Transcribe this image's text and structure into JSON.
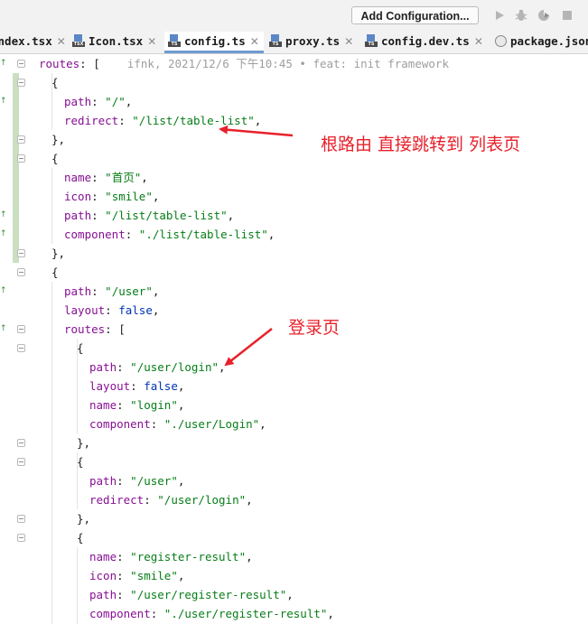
{
  "toolbar": {
    "add_configuration_label": "Add Configuration...",
    "icons": [
      "run-icon",
      "debug-icon",
      "coverage-icon",
      "stop-icon"
    ]
  },
  "tabs": [
    {
      "label": "index.tsx",
      "icon": "tsx-file-icon",
      "active": false
    },
    {
      "label": "Icon.tsx",
      "icon": "tsx-file-icon",
      "active": false
    },
    {
      "label": "config.ts",
      "icon": "ts-file-icon",
      "active": true
    },
    {
      "label": "proxy.ts",
      "icon": "ts-file-icon",
      "active": false
    },
    {
      "label": "config.dev.ts",
      "icon": "ts-file-icon",
      "active": false
    },
    {
      "label": "package.json",
      "icon": "json-file-icon",
      "active": false
    }
  ],
  "editor": {
    "blame": "ifnk, 2021/12/6 下午10:45 • feat: init framework",
    "lines": [
      [
        {
          "t": "routes",
          "c": "key"
        },
        {
          "t": ": [",
          "c": "pun"
        }
      ],
      [
        {
          "t": "{",
          "c": "pun"
        }
      ],
      [
        {
          "t": "path",
          "c": "key"
        },
        {
          "t": ": ",
          "c": "pun"
        },
        {
          "t": "\"/\"",
          "c": "str"
        },
        {
          "t": ",",
          "c": "pun"
        }
      ],
      [
        {
          "t": "redirect",
          "c": "key"
        },
        {
          "t": ": ",
          "c": "pun"
        },
        {
          "t": "\"/list/table-list\"",
          "c": "str"
        },
        {
          "t": ",",
          "c": "pun"
        }
      ],
      [
        {
          "t": "},",
          "c": "pun"
        }
      ],
      [
        {
          "t": "{",
          "c": "pun"
        }
      ],
      [
        {
          "t": "name",
          "c": "key"
        },
        {
          "t": ": ",
          "c": "pun"
        },
        {
          "t": "\"首页\"",
          "c": "str"
        },
        {
          "t": ",",
          "c": "pun"
        }
      ],
      [
        {
          "t": "icon",
          "c": "key"
        },
        {
          "t": ": ",
          "c": "pun"
        },
        {
          "t": "\"smile\"",
          "c": "str"
        },
        {
          "t": ",",
          "c": "pun"
        }
      ],
      [
        {
          "t": "path",
          "c": "key"
        },
        {
          "t": ": ",
          "c": "pun"
        },
        {
          "t": "\"/list/table-list\"",
          "c": "str"
        },
        {
          "t": ",",
          "c": "pun"
        }
      ],
      [
        {
          "t": "component",
          "c": "key"
        },
        {
          "t": ": ",
          "c": "pun"
        },
        {
          "t": "\"./list/table-list\"",
          "c": "str"
        },
        {
          "t": ",",
          "c": "pun"
        }
      ],
      [
        {
          "t": "},",
          "c": "pun"
        }
      ],
      [
        {
          "t": "{",
          "c": "pun"
        }
      ],
      [
        {
          "t": "path",
          "c": "key"
        },
        {
          "t": ": ",
          "c": "pun"
        },
        {
          "t": "\"/user\"",
          "c": "str"
        },
        {
          "t": ",",
          "c": "pun"
        }
      ],
      [
        {
          "t": "layout",
          "c": "key"
        },
        {
          "t": ": ",
          "c": "pun"
        },
        {
          "t": "false",
          "c": "kw"
        },
        {
          "t": ",",
          "c": "pun"
        }
      ],
      [
        {
          "t": "routes",
          "c": "key"
        },
        {
          "t": ": [",
          "c": "pun"
        }
      ],
      [
        {
          "t": "{",
          "c": "pun"
        }
      ],
      [
        {
          "t": "path",
          "c": "key"
        },
        {
          "t": ": ",
          "c": "pun"
        },
        {
          "t": "\"/user/login\"",
          "c": "str"
        },
        {
          "t": ",",
          "c": "pun"
        }
      ],
      [
        {
          "t": "layout",
          "c": "key"
        },
        {
          "t": ": ",
          "c": "pun"
        },
        {
          "t": "false",
          "c": "kw"
        },
        {
          "t": ",",
          "c": "pun"
        }
      ],
      [
        {
          "t": "name",
          "c": "key"
        },
        {
          "t": ": ",
          "c": "pun"
        },
        {
          "t": "\"login\"",
          "c": "str"
        },
        {
          "t": ",",
          "c": "pun"
        }
      ],
      [
        {
          "t": "component",
          "c": "key"
        },
        {
          "t": ": ",
          "c": "pun"
        },
        {
          "t": "\"./user/Login\"",
          "c": "str"
        },
        {
          "t": ",",
          "c": "pun"
        }
      ],
      [
        {
          "t": "},",
          "c": "pun"
        }
      ],
      [
        {
          "t": "{",
          "c": "pun"
        }
      ],
      [
        {
          "t": "path",
          "c": "key"
        },
        {
          "t": ": ",
          "c": "pun"
        },
        {
          "t": "\"/user\"",
          "c": "str"
        },
        {
          "t": ",",
          "c": "pun"
        }
      ],
      [
        {
          "t": "redirect",
          "c": "key"
        },
        {
          "t": ": ",
          "c": "pun"
        },
        {
          "t": "\"/user/login\"",
          "c": "str"
        },
        {
          "t": ",",
          "c": "pun"
        }
      ],
      [
        {
          "t": "},",
          "c": "pun"
        }
      ],
      [
        {
          "t": "{",
          "c": "pun"
        }
      ],
      [
        {
          "t": "name",
          "c": "key"
        },
        {
          "t": ": ",
          "c": "pun"
        },
        {
          "t": "\"register-result\"",
          "c": "str"
        },
        {
          "t": ",",
          "c": "pun"
        }
      ],
      [
        {
          "t": "icon",
          "c": "key"
        },
        {
          "t": ": ",
          "c": "pun"
        },
        {
          "t": "\"smile\"",
          "c": "str"
        },
        {
          "t": ",",
          "c": "pun"
        }
      ],
      [
        {
          "t": "path",
          "c": "key"
        },
        {
          "t": ": ",
          "c": "pun"
        },
        {
          "t": "\"/user/register-result\"",
          "c": "str"
        },
        {
          "t": ",",
          "c": "pun"
        }
      ],
      [
        {
          "t": "component",
          "c": "key"
        },
        {
          "t": ": ",
          "c": "pun"
        },
        {
          "t": "\"./user/register-result\"",
          "c": "str"
        },
        {
          "t": ",",
          "c": "pun"
        }
      ]
    ]
  },
  "annotations": {
    "root_redirect": "根路由 直接跳转到 列表页",
    "login_page": "登录页"
  },
  "colors": {
    "annotation": "#e8212b",
    "key": "#871094",
    "string": "#067d17",
    "keyword": "#0033b3",
    "active_tab_underline": "#6f9bd1"
  }
}
